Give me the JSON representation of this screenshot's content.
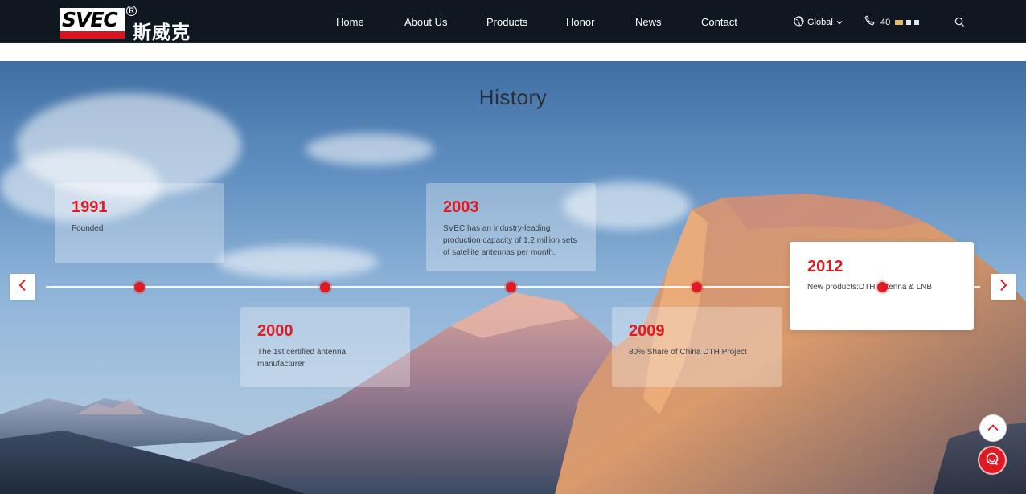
{
  "brand": {
    "mark": "SVEC",
    "registered": "R",
    "chinese_name": "斯威克"
  },
  "nav": {
    "items": [
      {
        "label": "Home"
      },
      {
        "label": "About Us"
      },
      {
        "label": "Products"
      },
      {
        "label": "Honor"
      },
      {
        "label": "News"
      },
      {
        "label": "Contact"
      }
    ]
  },
  "tools": {
    "language_label": "Global",
    "language_icon": "globe-icon",
    "phone_prefix": "40",
    "phone_icon": "phone-icon",
    "search_icon": "search-icon"
  },
  "history": {
    "title": "History",
    "events": [
      {
        "year": "1991",
        "description": "Founded"
      },
      {
        "year": "2000",
        "description": "The 1st certified antenna manufacturer"
      },
      {
        "year": "2003",
        "description": "SVEC has an industry-leading production capacity of 1.2 million sets of satellite antennas per month."
      },
      {
        "year": "2009",
        "description": "80% Share of China DTH Project"
      },
      {
        "year": "2012",
        "description": "New products:DTH antenna & LNB"
      }
    ],
    "active_year": "2012",
    "prev_icon": "chevron-left-icon",
    "next_icon": "chevron-right-icon"
  },
  "floating": {
    "top_icon": "chevron-up-icon",
    "service_icon": "headset-icon"
  },
  "colors": {
    "header_bg": "#0f1720",
    "accent_red": "#e01a22",
    "nav_text": "#ffffff"
  }
}
